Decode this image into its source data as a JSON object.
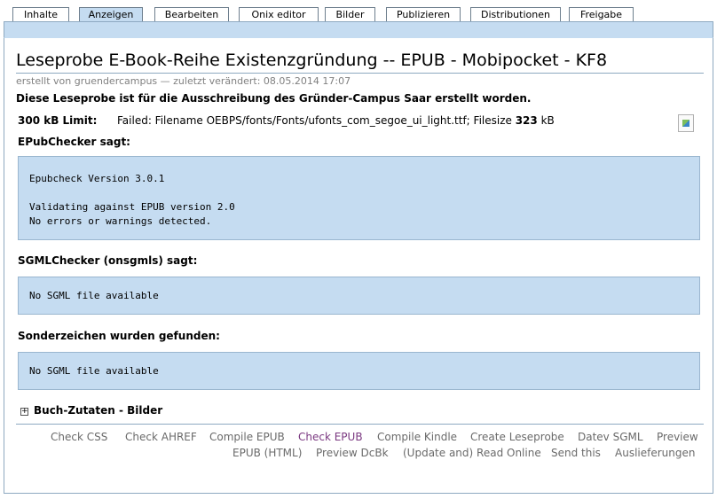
{
  "tabs": [
    {
      "label": "Inhalte"
    },
    {
      "label": "Anzeigen",
      "active": true
    },
    {
      "label": "Bearbeiten"
    },
    {
      "label": "Onix editor"
    },
    {
      "label": "Bilder"
    },
    {
      "label": "Publizieren"
    },
    {
      "label": "Distributionen"
    },
    {
      "label": "Freigabe"
    }
  ],
  "page": {
    "title": "Leseprobe E-Book-Reihe Existenzgründung -- EPUB - Mobipocket - KF8",
    "meta": "erstellt von gruendercampus — zuletzt verändert: 08.05.2014 17:07",
    "description": "Diese Leseprobe ist für die Ausschreibung des Gründer-Campus Saar erstellt worden."
  },
  "limit": {
    "label": "300 kB Limit:",
    "text_prefix": "Failed: Filename OEBPS/fonts/Fonts/ufonts_com_segoe_ui_light.ttf; Filesize ",
    "filesize": "323",
    "unit": " kB"
  },
  "sections": {
    "epubchecker": {
      "heading": "EPubChecker sagt:",
      "lines": [
        "Epubcheck Version 3.0.1",
        "",
        "Validating against EPUB version 2.0",
        "No errors or warnings detected."
      ]
    },
    "sgmlchecker": {
      "heading": "SGMLChecker (onsgmls) sagt:",
      "lines": [
        "No SGML file available"
      ]
    },
    "sonderzeichen": {
      "heading": "Sonderzeichen wurden gefunden:",
      "lines": [
        "No SGML file available"
      ]
    }
  },
  "expander": {
    "icon": "plus-box-icon",
    "label": "Buch-Zutaten - Bilder"
  },
  "actions": {
    "check_css": "Check CSS",
    "check_ahref": "Check AHREF",
    "compile_epub": "Compile EPUB",
    "check_epub": "Check EPUB",
    "compile_kindle": "Compile Kindle",
    "create_leseprobe": "Create Leseprobe",
    "datev_sgml": "Datev SGML",
    "preview_epub_html_1": "Preview",
    "preview_epub_html_2": "EPUB (HTML)",
    "preview_dcbk": "Preview DcBk",
    "update_read_online": "(Update and) Read Online",
    "send_this": "Send this",
    "auslieferungen": "Auslieferungen"
  },
  "colors": {
    "tab_active": "#c5dcf1",
    "box_bg": "#c5dcf1",
    "action_link": "#6a6a6a",
    "visited_link": "#7a3880"
  }
}
